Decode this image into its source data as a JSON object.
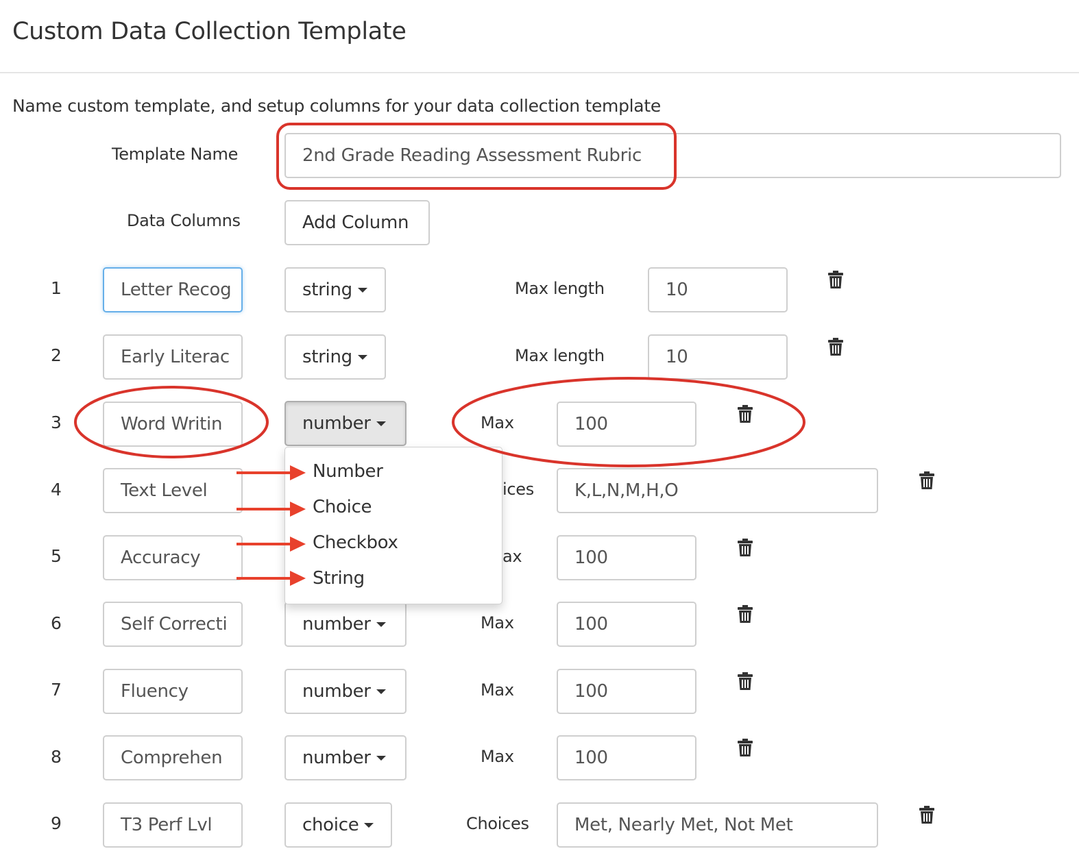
{
  "page": {
    "title": "Custom Data Collection Template",
    "intro": "Name custom template, and setup columns for your data collection template"
  },
  "template_name": {
    "label": "Template Name",
    "value": "2nd Grade Reading Assessment Rubric"
  },
  "data_columns": {
    "label": "Data Columns",
    "add_button": "Add Column"
  },
  "columns": [
    {
      "num": "1",
      "name": "Letter Recog",
      "type": "string",
      "param_label": "Max length",
      "param_value": "10"
    },
    {
      "num": "2",
      "name": "Early Literac",
      "type": "string",
      "param_label": "Max length",
      "param_value": "10"
    },
    {
      "num": "3",
      "name": "Word Writin",
      "type": "number",
      "param_label": "Max",
      "param_value": "100"
    },
    {
      "num": "4",
      "name": "Text Level",
      "type": "",
      "param_label": "ices",
      "param_value": "K,L,N,M,H,O"
    },
    {
      "num": "5",
      "name": "Accuracy",
      "type": "",
      "param_label": "ax",
      "param_value": "100"
    },
    {
      "num": "6",
      "name": "Self Correcti",
      "type": "number",
      "param_label": "Max",
      "param_value": "100"
    },
    {
      "num": "7",
      "name": "Fluency",
      "type": "number",
      "param_label": "Max",
      "param_value": "100"
    },
    {
      "num": "8",
      "name": "Comprehen",
      "type": "number",
      "param_label": "Max",
      "param_value": "100"
    },
    {
      "num": "9",
      "name": "T3 Perf Lvl",
      "type": "choice",
      "param_label": "Choices",
      "param_value": "Met, Nearly Met, Not Met"
    }
  ],
  "type_dropdown": {
    "open_on_row": "3",
    "options": [
      "Number",
      "Choice",
      "Checkbox",
      "String"
    ]
  },
  "annotation_colors": {
    "highlight": "#d9342b",
    "arrow": "#e8412c"
  },
  "icons": {
    "delete": "trash-icon",
    "dropdown": "caret-down-icon"
  }
}
